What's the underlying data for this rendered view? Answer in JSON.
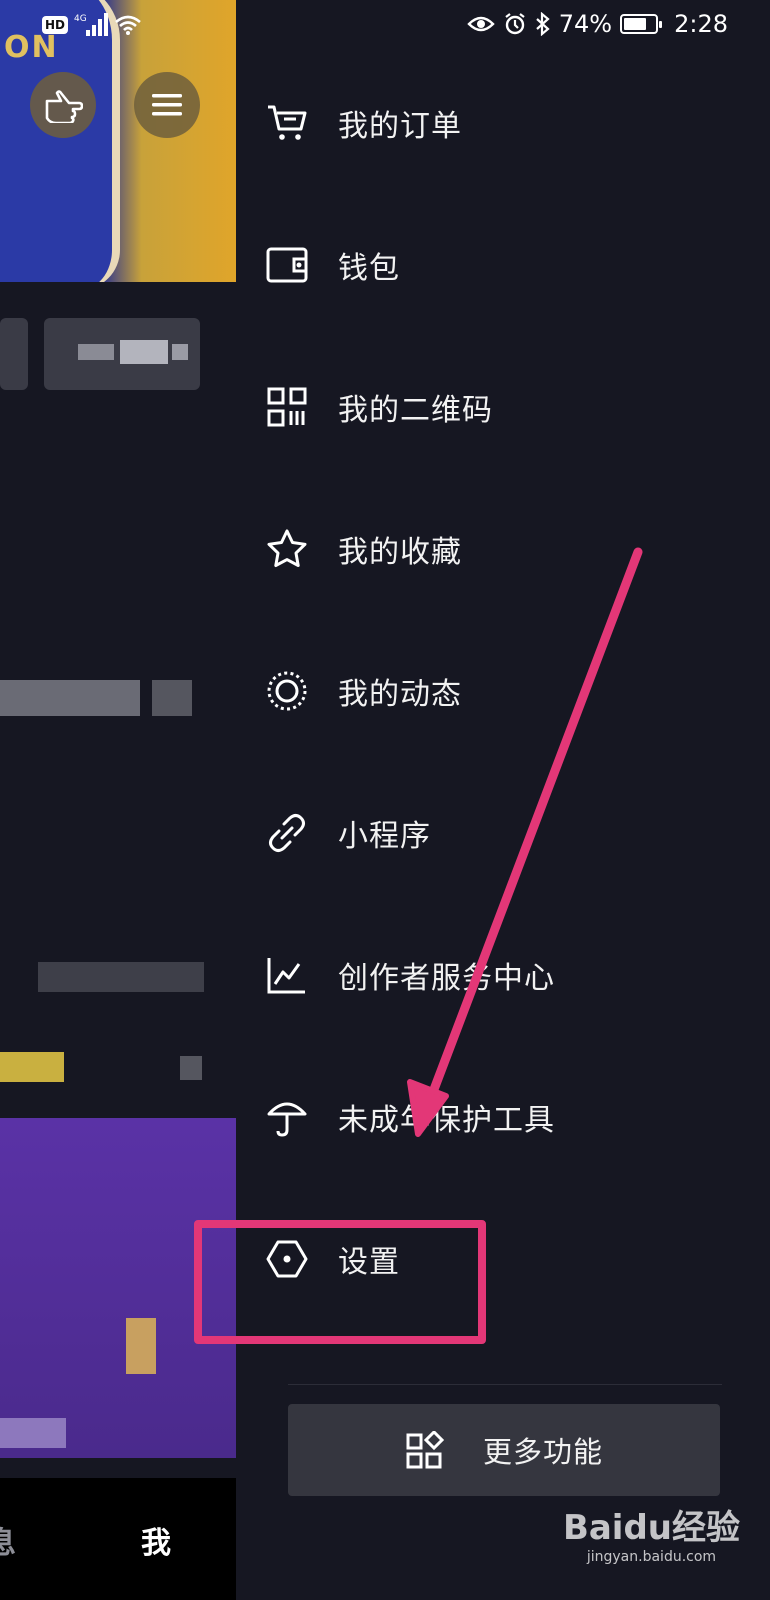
{
  "status_bar": {
    "hd": "HD",
    "network": "4G",
    "battery": "74%",
    "battery_level": 0.74,
    "time": "2:28"
  },
  "drawer": {
    "items": [
      {
        "label": "我的订单",
        "icon": "cart-icon"
      },
      {
        "label": "钱包",
        "icon": "wallet-icon"
      },
      {
        "label": "我的二维码",
        "icon": "qr-code-icon"
      },
      {
        "label": "我的收藏",
        "icon": "star-icon"
      },
      {
        "label": "我的动态",
        "icon": "moments-icon"
      },
      {
        "label": "小程序",
        "icon": "link-icon"
      },
      {
        "label": "创作者服务中心",
        "icon": "chart-icon"
      },
      {
        "label": "未成年保护工具",
        "icon": "umbrella-icon"
      },
      {
        "label": "设置",
        "icon": "hexagon-settings-icon"
      }
    ],
    "more_button": {
      "label": "更多功能",
      "icon": "grid-apps-icon"
    }
  },
  "background_app": {
    "bottom_nav": {
      "partial_label": "消息",
      "visible_fragment": "息",
      "me_label": "我"
    }
  },
  "annotation": {
    "color": "#e33777"
  },
  "watermark": {
    "brand": "Baidu经验",
    "domain": "jingyan.baidu.com"
  }
}
